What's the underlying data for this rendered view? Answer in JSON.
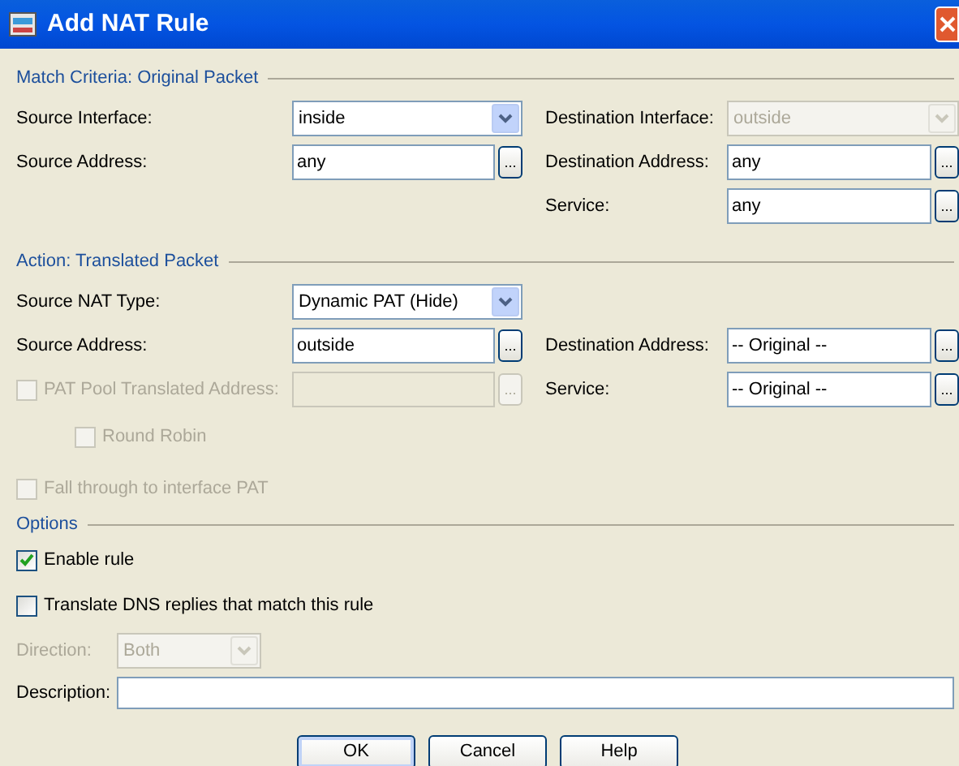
{
  "window": {
    "title": "Add NAT Rule"
  },
  "sections": [
    {
      "title": "Match Criteria: Original Packet",
      "rows": [
        {
          "left": {
            "kind": "dropdown",
            "label": "Source Interface:",
            "value": "inside",
            "disabled": false
          },
          "right": {
            "kind": "dropdown",
            "label": "Destination Interface:",
            "value": "outside",
            "disabled": true
          }
        },
        {
          "left": {
            "kind": "browse",
            "label": "Source Address:",
            "value": "any",
            "button": "...",
            "disabled": false
          },
          "right": {
            "kind": "browse",
            "label": "Destination Address:",
            "value": "any",
            "button": "...",
            "disabled": false
          }
        },
        {
          "right": {
            "kind": "browse",
            "label": "Service:",
            "value": "any",
            "button": "...",
            "disabled": false
          }
        }
      ]
    },
    {
      "title": "Action: Translated Packet",
      "rows": [
        {
          "left": {
            "kind": "dropdown",
            "label": "Source NAT Type:",
            "value": "Dynamic PAT (Hide)",
            "disabled": false
          }
        },
        {
          "left": {
            "kind": "browse",
            "label": "Source Address:",
            "value": "outside",
            "button": "...",
            "disabled": false
          },
          "right": {
            "kind": "browse",
            "label": "Destination Address:",
            "value": "-- Original --",
            "button": "...",
            "disabled": false
          }
        },
        {
          "left": {
            "kind": "check_browse",
            "label": "PAT Pool Translated Address:",
            "checked": false,
            "button": "...",
            "disabled": true,
            "children": [
              {
                "label": "Round Robin",
                "checked": false,
                "disabled": true
              }
            ]
          },
          "right": {
            "kind": "browse",
            "label": "Service:",
            "value": "-- Original --",
            "button": "...",
            "disabled": false
          }
        }
      ],
      "checkboxes": [
        {
          "label": "Fall through to interface PAT",
          "checked": false,
          "disabled": true
        }
      ]
    },
    {
      "title": "Options",
      "checkboxes": [
        {
          "label": "Enable rule",
          "checked": true,
          "disabled": false
        },
        {
          "label": "Translate DNS replies that match this rule",
          "checked": false,
          "disabled": false
        }
      ],
      "direction": {
        "label": "Direction:",
        "value": "Both",
        "disabled": true
      },
      "description": {
        "label": "Description:"
      }
    }
  ],
  "buttons": [
    {
      "label": "OK",
      "default": true
    },
    {
      "label": "Cancel",
      "default": false
    },
    {
      "label": "Help",
      "default": false
    }
  ]
}
